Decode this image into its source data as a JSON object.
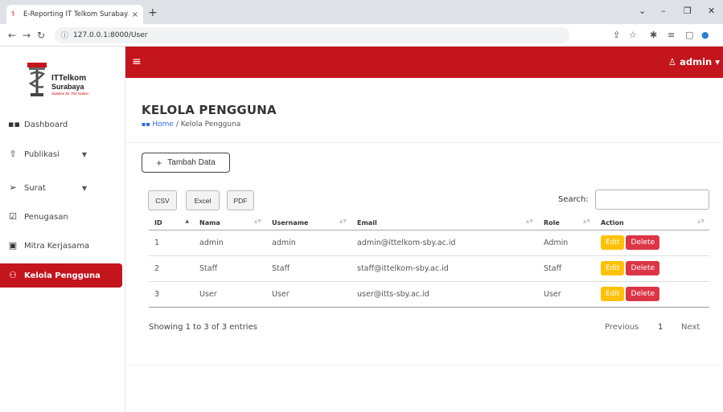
{
  "browser": {
    "tab_title": "E-Reporting IT Telkom Surabaya",
    "tab_close": "×",
    "new_tab": "+",
    "url": "127.0.0.1:8000/User"
  },
  "brand": {
    "line1": "ITTelkom",
    "line2": "Surabaya",
    "tagline": "Solution for The Nation",
    "primary_color": "#c4141c"
  },
  "sidebar": {
    "items": [
      {
        "label": "Dashboard",
        "icon": "grid-icon"
      },
      {
        "label": "Publikasi",
        "icon": "upload-icon",
        "has_children": true
      },
      {
        "label": "Surat",
        "icon": "send-icon",
        "has_children": true
      },
      {
        "label": "Penugasan",
        "icon": "clipboard-check-icon"
      },
      {
        "label": "Mitra Kerjasama",
        "icon": "id-card-icon"
      },
      {
        "label": "Kelola Pengguna",
        "icon": "users-icon",
        "active": true
      }
    ]
  },
  "topbar": {
    "user_label": "admin"
  },
  "page": {
    "title": "KELOLA PENGGUNA",
    "breadcrumb_home": "Home",
    "breadcrumb_sep": " / ",
    "breadcrumb_current": "Kelola Pengguna",
    "add_button": "Tambah Data"
  },
  "table_tools": {
    "export_buttons": [
      "CSV",
      "Excel",
      "PDF"
    ],
    "search_label": "Search:",
    "search_value": ""
  },
  "table": {
    "headers": [
      "ID",
      "Nama",
      "Username",
      "Email",
      "Role",
      "Action"
    ],
    "rows": [
      {
        "id": "1",
        "nama": "admin",
        "username": "admin",
        "email": "admin@ittelkom-sby.ac.id",
        "role": "Admin"
      },
      {
        "id": "2",
        "nama": "Staff",
        "username": "Staff",
        "email": "staff@ittelkom-sby.ac.id",
        "role": "Staff"
      },
      {
        "id": "3",
        "nama": "User",
        "username": "User",
        "email": "user@itts-sby.ac.id",
        "role": "User"
      }
    ],
    "edit_label": "Edit",
    "delete_label": "Delete",
    "edit_color": "#ffc107",
    "delete_color": "#dc3545"
  },
  "footer": {
    "info": "Showing 1 to 3 of 3 entries",
    "previous": "Previous",
    "current_page": "1",
    "next": "Next"
  }
}
